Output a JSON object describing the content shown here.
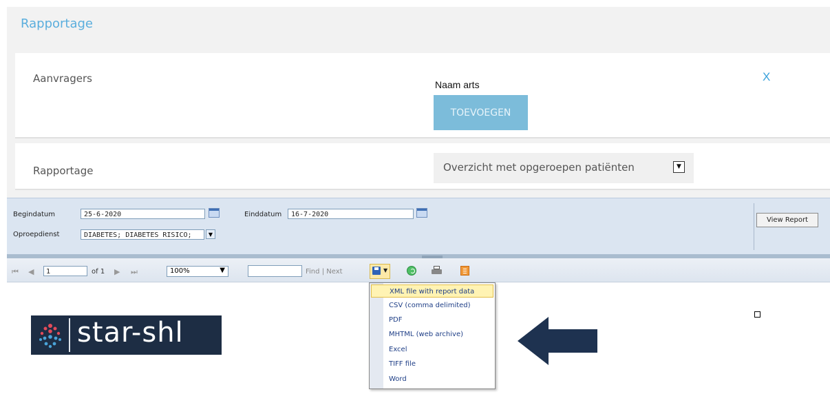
{
  "page": {
    "title": "Rapportage"
  },
  "aanvragers": {
    "label": "Aanvragers",
    "field_label": "Naam arts",
    "add_button": "TOEVOEGEN",
    "close": "X"
  },
  "rapportage": {
    "label": "Rapportage",
    "selected_report": "Overzicht met opgeroepen patiënten"
  },
  "params": {
    "begin_label": "Begindatum",
    "begin_value": "25-6-2020",
    "end_label": "Einddatum",
    "end_value": "16-7-2020",
    "service_label": "Oproepdienst",
    "service_value": "DIABETES; DIABETES RISICO;",
    "view_report": "View Report"
  },
  "toolbar": {
    "first": "⏮",
    "prev": "◀",
    "page_value": "1",
    "of_pages": "of 1",
    "next": "▶",
    "last": "⏭",
    "zoom": "100%",
    "find": "Find",
    "find_sep": "|",
    "next_label": "Next"
  },
  "export_menu": {
    "items": [
      "XML file with report data",
      "CSV (comma delimited)",
      "PDF",
      "MHTML (web archive)",
      "Excel",
      "TIFF file",
      "Word"
    ],
    "highlighted": "XML file with report data"
  },
  "logo": {
    "text": "star-shl"
  },
  "colors": {
    "title_blue": "#5aaedd",
    "add_button_bg": "#7cbcda",
    "logo_bg": "#1d2d44",
    "arrow": "#1e3250",
    "menu_highlight": "#fff3b3"
  }
}
